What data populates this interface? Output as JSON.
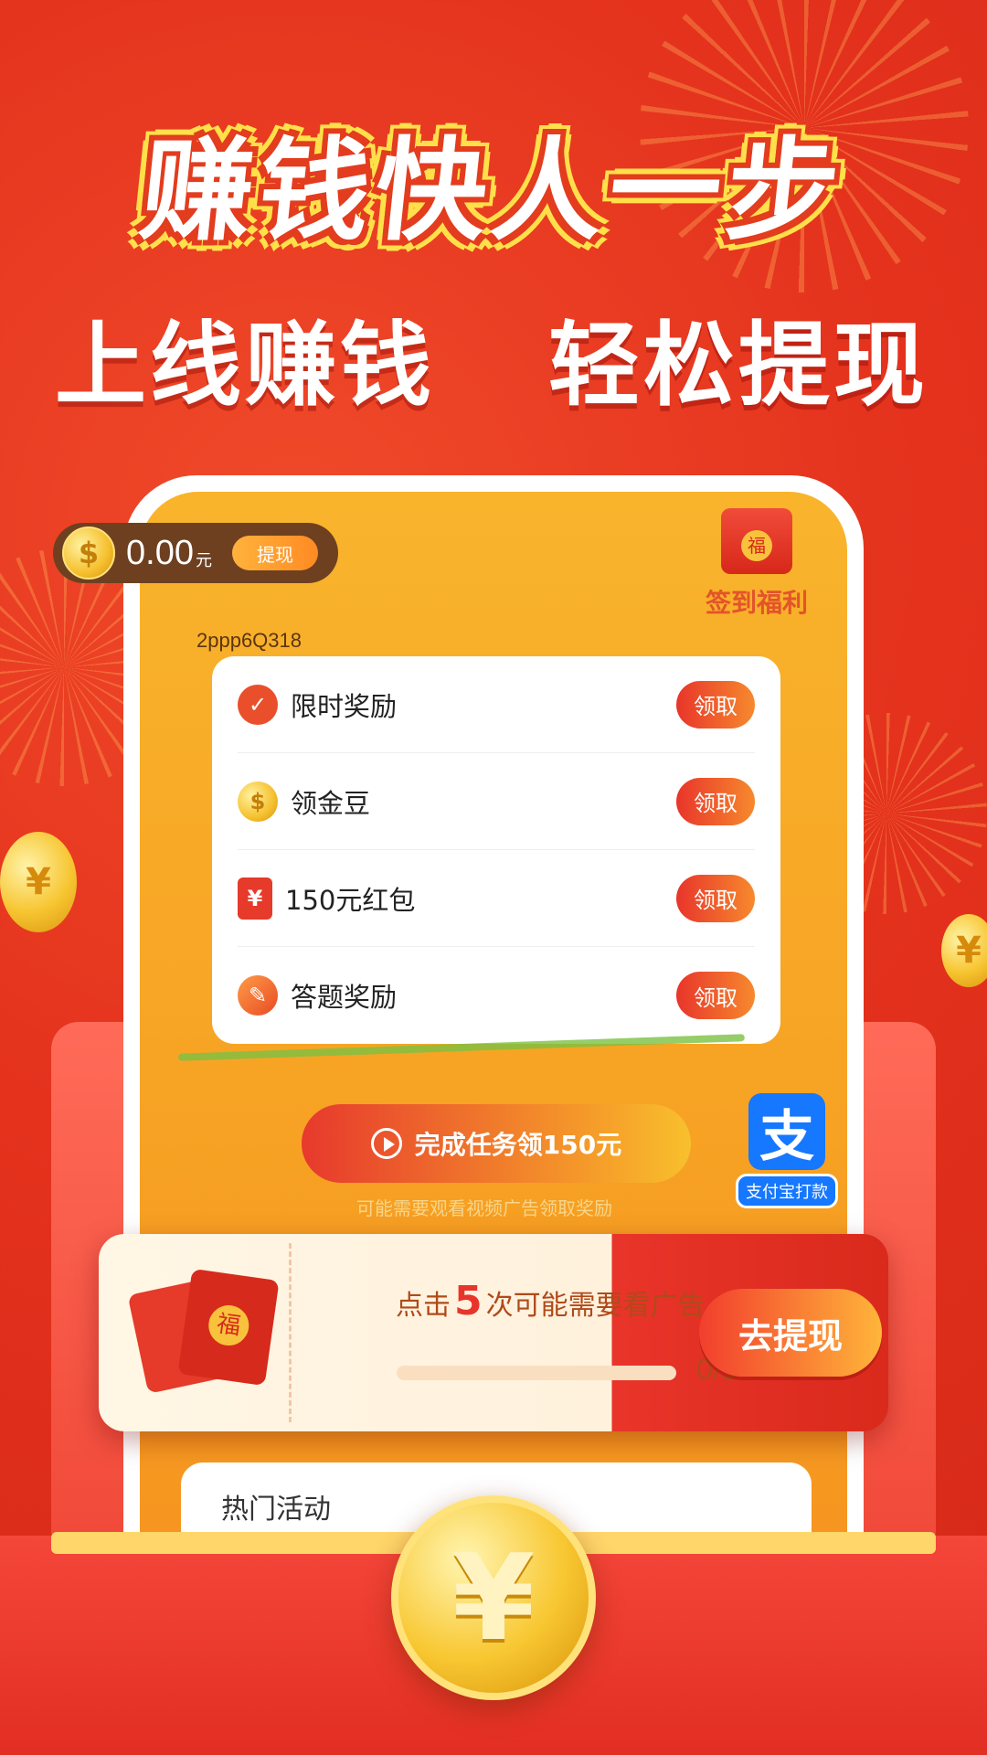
{
  "banner": {
    "headline": "赚钱快人一步",
    "subtitle_left": "上线赚钱",
    "subtitle_right": "轻松提现"
  },
  "wallet": {
    "balance": "0.00",
    "unit": "元",
    "withdraw_label": "提现",
    "coin_symbol": "$"
  },
  "signin": {
    "label": "签到福利"
  },
  "user": {
    "id": "2ppp6Q318"
  },
  "tasks": [
    {
      "label": "限时奖励",
      "button": "领取",
      "icon": "check-icon"
    },
    {
      "label": "领金豆",
      "button": "领取",
      "icon": "coin-icon"
    },
    {
      "label": "150元红包",
      "button": "领取",
      "icon": "red-packet-icon"
    },
    {
      "label": "答题奖励",
      "button": "领取",
      "icon": "quiz-icon"
    }
  ],
  "main_task": {
    "label": "完成任务领150元",
    "hint": "可能需要观看视频广告领取奖励"
  },
  "alipay": {
    "logo": "支",
    "label": "支付宝打款"
  },
  "ticket": {
    "text_before": "点击",
    "count": "5",
    "text_after": "次可能需要看广告",
    "progress_text": "0/5",
    "progress": 0,
    "button": "去提现"
  },
  "hot": {
    "title": "热门活动"
  },
  "big_coin": {
    "symbol": "¥"
  },
  "colors": {
    "bg_red": "#e4321d",
    "screen_orange": "#f7a424",
    "accent_yellow": "#ffe04a",
    "alipay_blue": "#1677ff"
  }
}
